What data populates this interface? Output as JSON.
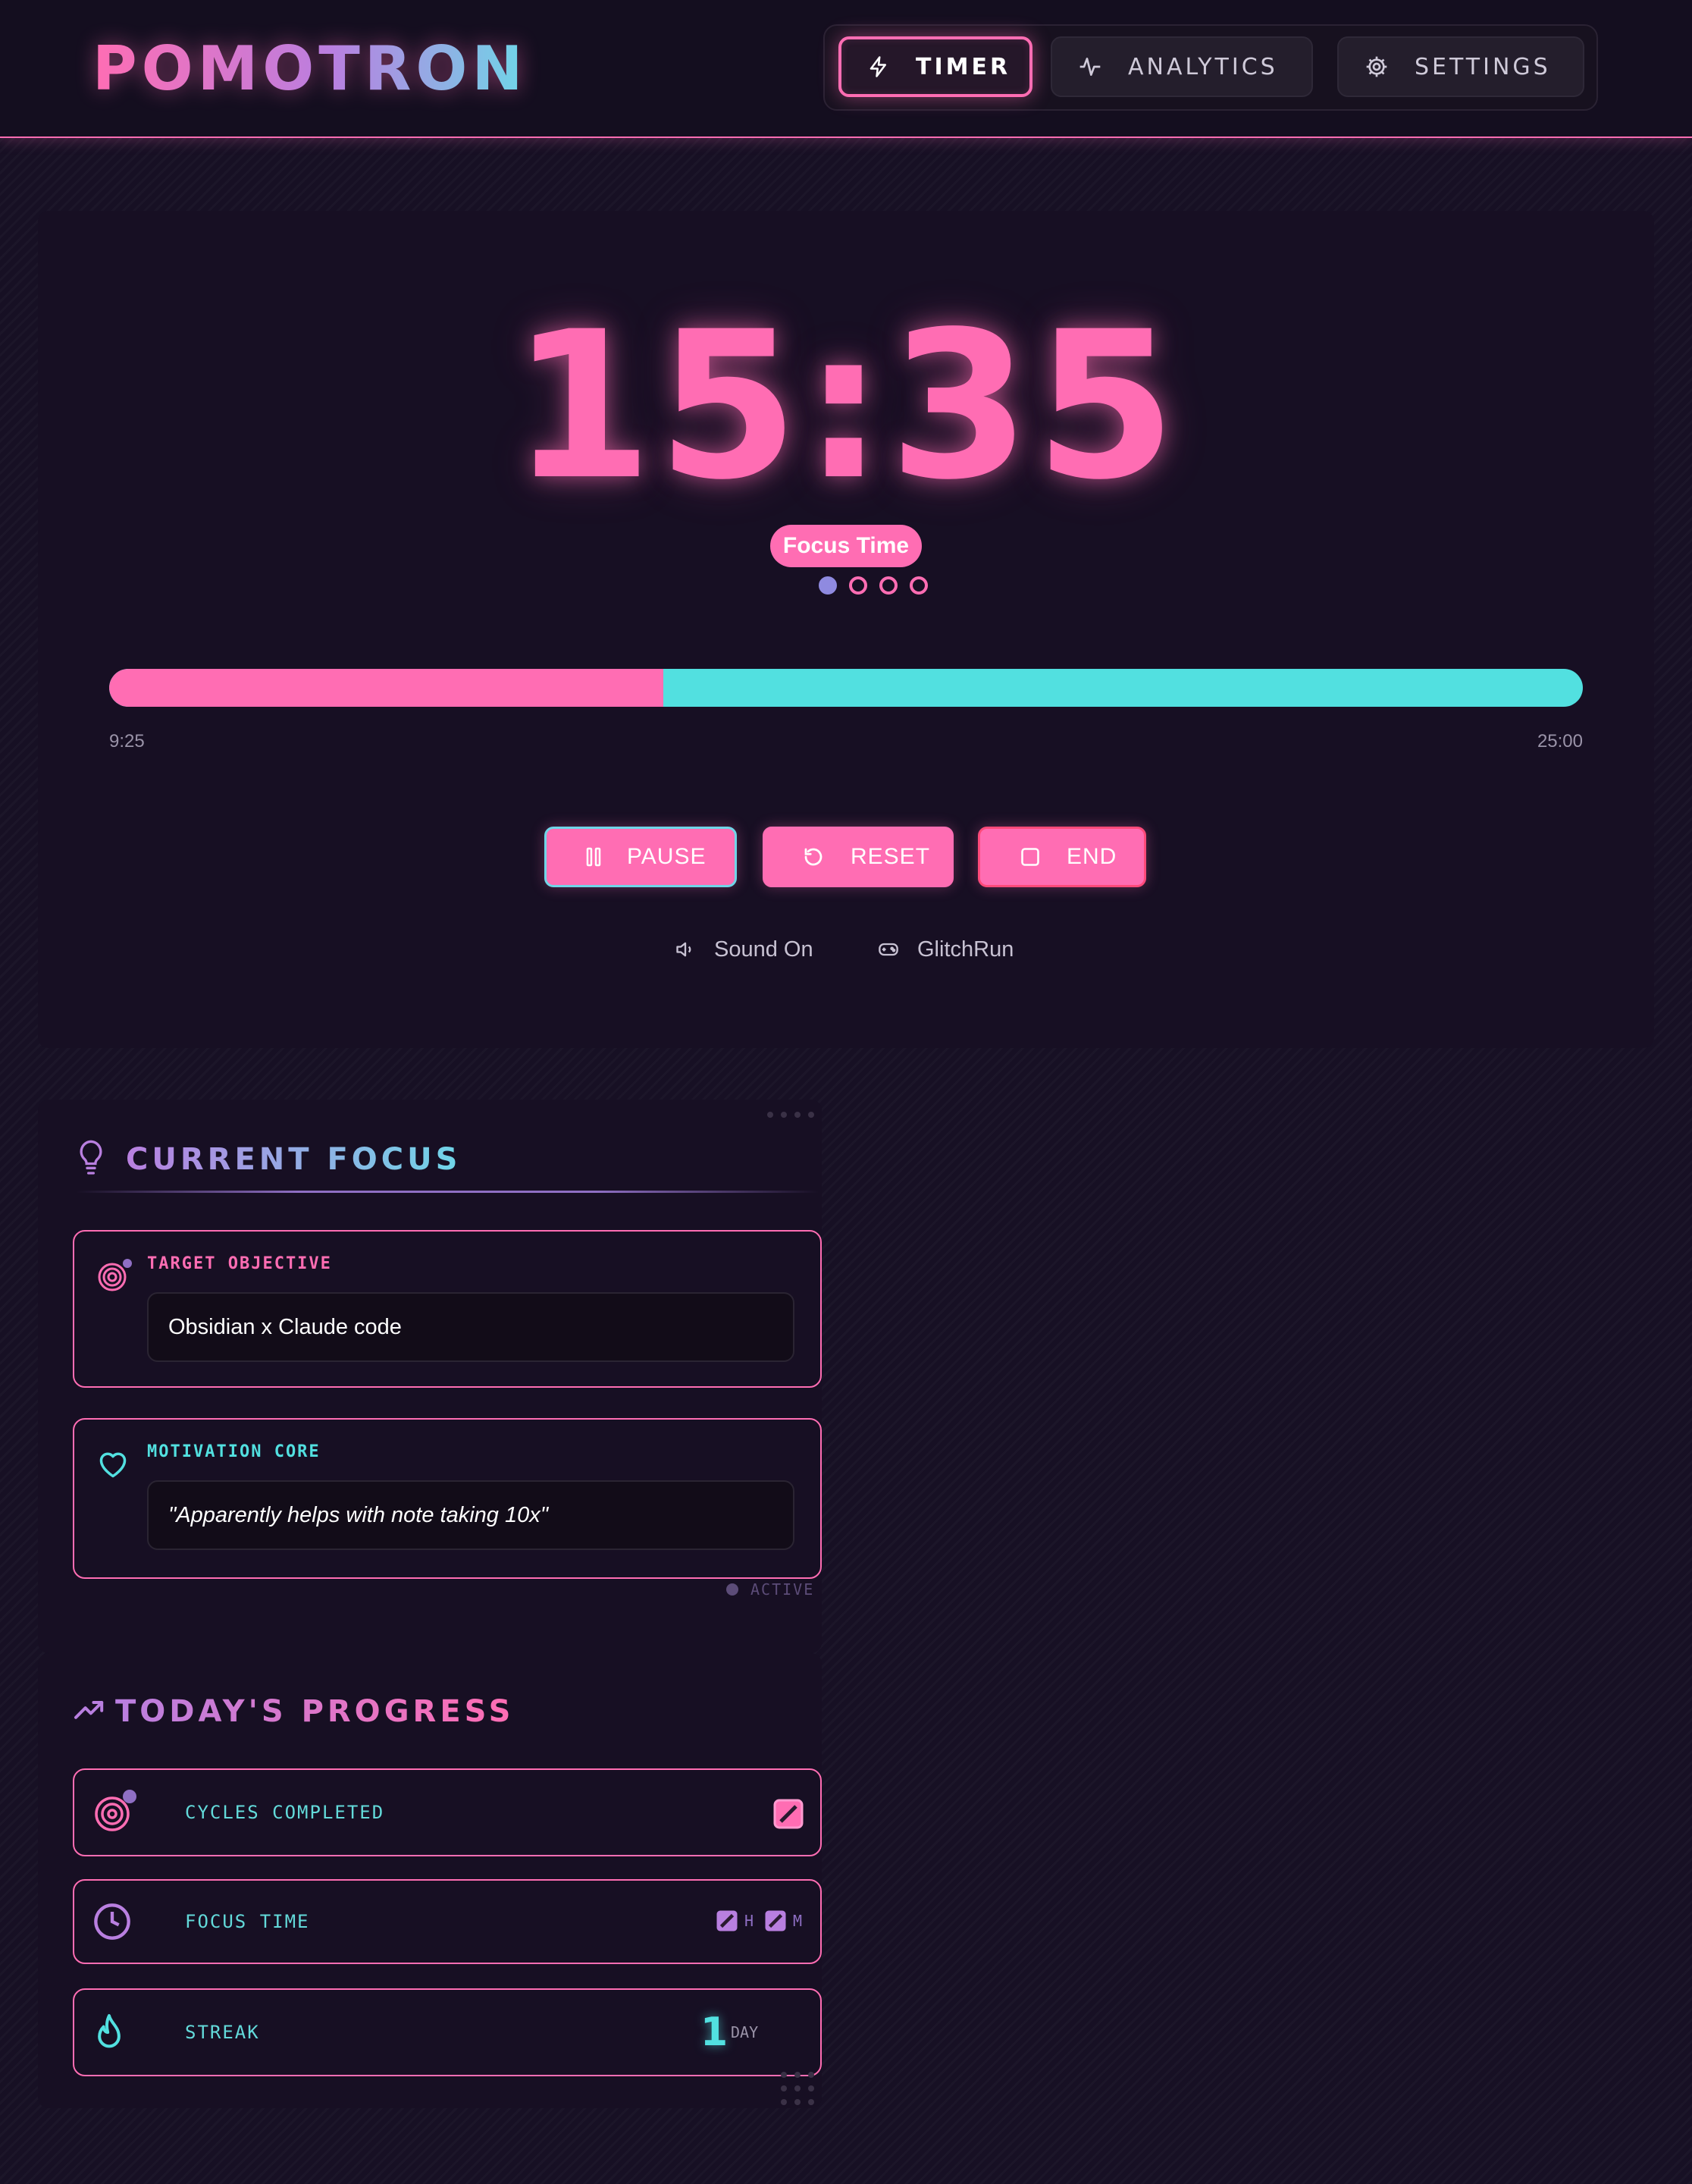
{
  "app": {
    "logo": "POMOTRON"
  },
  "nav": {
    "items": [
      {
        "label": "TIMER",
        "icon": "bolt-icon",
        "active": true
      },
      {
        "label": "ANALYTICS",
        "icon": "activity-icon",
        "active": false
      },
      {
        "label": "SETTINGS",
        "icon": "gear-icon",
        "active": false
      }
    ]
  },
  "timer": {
    "time": "15:35",
    "mode": "Focus Time",
    "cycle_dots": {
      "total": 4,
      "current": 1
    },
    "elapsed_label": "9:25",
    "total_label": "25:00",
    "progress_fraction": 0.376,
    "controls": {
      "pause": "PAUSE",
      "reset": "RESET",
      "end": "END"
    },
    "options": {
      "sound": "Sound On",
      "game": "GlitchRun"
    }
  },
  "focus": {
    "title": "CURRENT FOCUS",
    "target_label": "TARGET OBJECTIVE",
    "target_value": "Obsidian x Claude code",
    "motivation_label": "MOTIVATION CORE",
    "motivation_value": "\"Apparently helps with note taking 10x\"",
    "status": "ACTIVE"
  },
  "progress": {
    "title": "TODAY'S PROGRESS",
    "cycles_label": "CYCLES COMPLETED",
    "focus_time_label": "FOCUS TIME",
    "hours_unit": "H",
    "minutes_unit": "M",
    "streak_label": "STREAK",
    "streak_value": "1",
    "streak_unit": "DAY"
  },
  "colors": {
    "accent_pink": "#ff6db3",
    "accent_cyan": "#52e0e0",
    "accent_purple": "#b97fe0",
    "background": "#171024"
  }
}
